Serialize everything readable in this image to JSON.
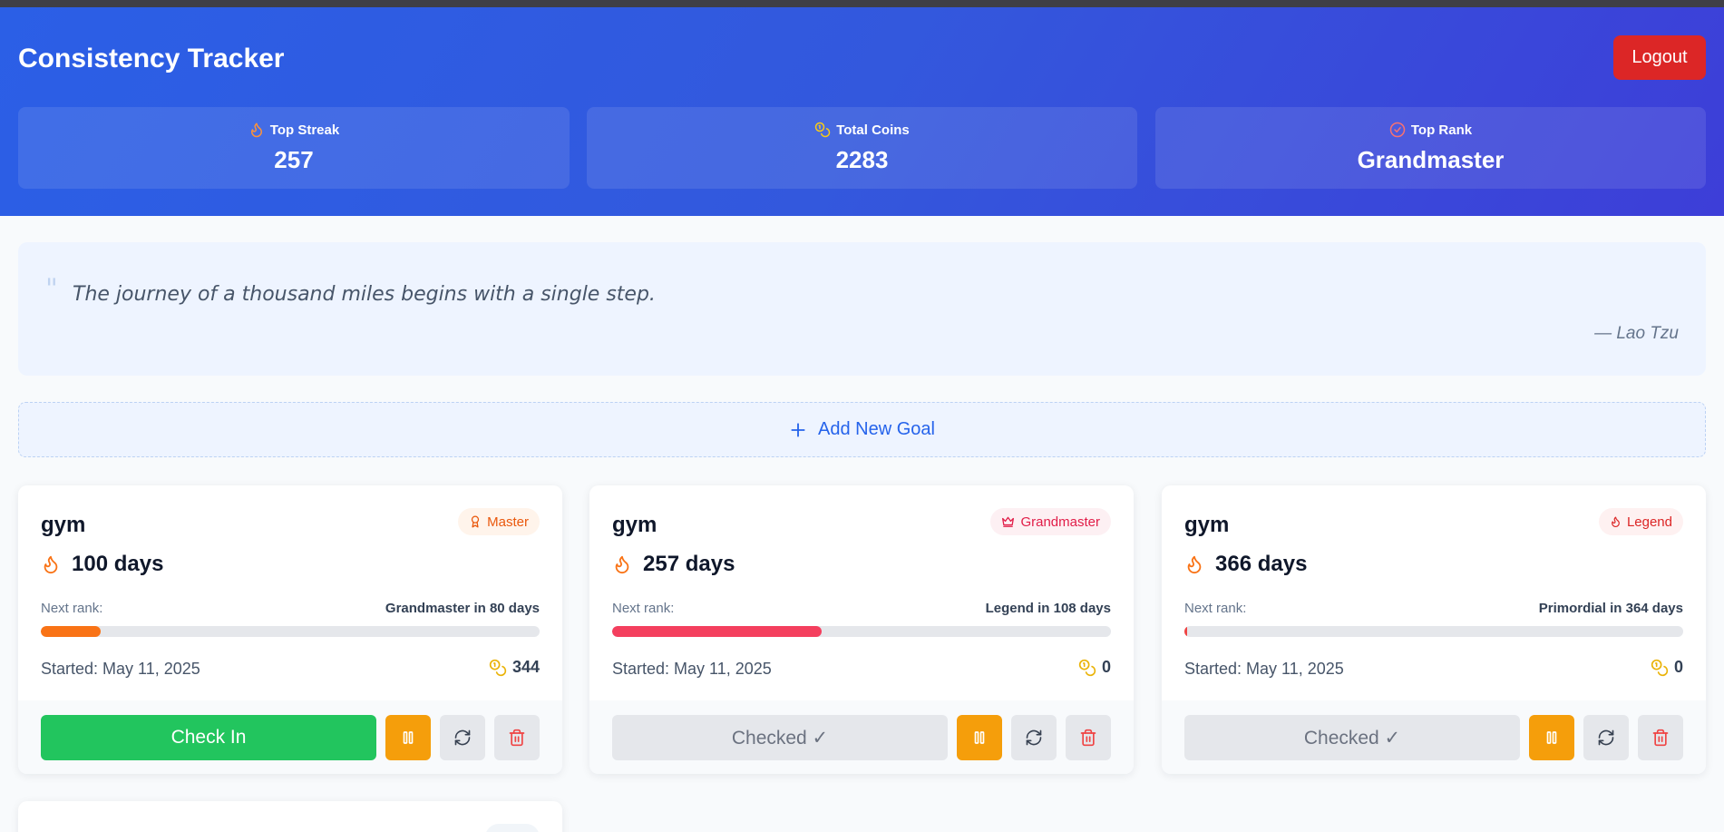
{
  "header": {
    "title": "Consistency Tracker",
    "logout_label": "Logout",
    "stats": [
      {
        "label": "Top Streak",
        "value": "257",
        "icon": "flame-icon"
      },
      {
        "label": "Total Coins",
        "value": "2283",
        "icon": "coins-icon"
      },
      {
        "label": "Top Rank",
        "value": "Grandmaster",
        "icon": "rank-icon"
      }
    ]
  },
  "quote": {
    "text": "The journey of a thousand miles begins with a single step.",
    "author": "— Lao Tzu"
  },
  "add_goal": {
    "label": "Add New Goal"
  },
  "goals": [
    {
      "name": "gym",
      "rank": "Master",
      "rank_color": "#ea580c",
      "rank_bg": "#fff4eb",
      "rank_icon": "award-icon",
      "streak": "100 days",
      "next_rank_label": "Next rank:",
      "next_rank_value": "Grandmaster in 80 days",
      "progress": 0.12,
      "progress_color": "#f97316",
      "started": "Started: May 11, 2025",
      "coins": "344",
      "checkin_label": "Check In",
      "checked": false
    },
    {
      "name": "gym",
      "rank": "Grandmaster",
      "rank_color": "#e11d48",
      "rank_bg": "#fdf0f3",
      "rank_icon": "crown-icon",
      "streak": "257 days",
      "next_rank_label": "Next rank:",
      "next_rank_value": "Legend in 108 days",
      "progress": 0.42,
      "progress_color": "#f43f5e",
      "started": "Started: May 11, 2025",
      "coins": "0",
      "checkin_label": "Checked ✓",
      "checked": true
    },
    {
      "name": "gym",
      "rank": "Legend",
      "rank_color": "#dc2626",
      "rank_bg": "#fef1f1",
      "rank_icon": "flame-icon",
      "streak": "366 days",
      "next_rank_label": "Next rank:",
      "next_rank_value": "Primordial in 364 days",
      "progress": 0.005,
      "progress_color": "#ef4444",
      "started": "Started: May 11, 2025",
      "coins": "0",
      "checkin_label": "Checked ✓",
      "checked": true
    }
  ],
  "colors": {
    "accent": "#2563eb",
    "logout": "#dc2626",
    "checkin": "#22c55e",
    "pause": "#f59e0b",
    "delete_icon": "#ef4444",
    "streak_icon": "#f97316",
    "coin_icon": "#eab308"
  }
}
